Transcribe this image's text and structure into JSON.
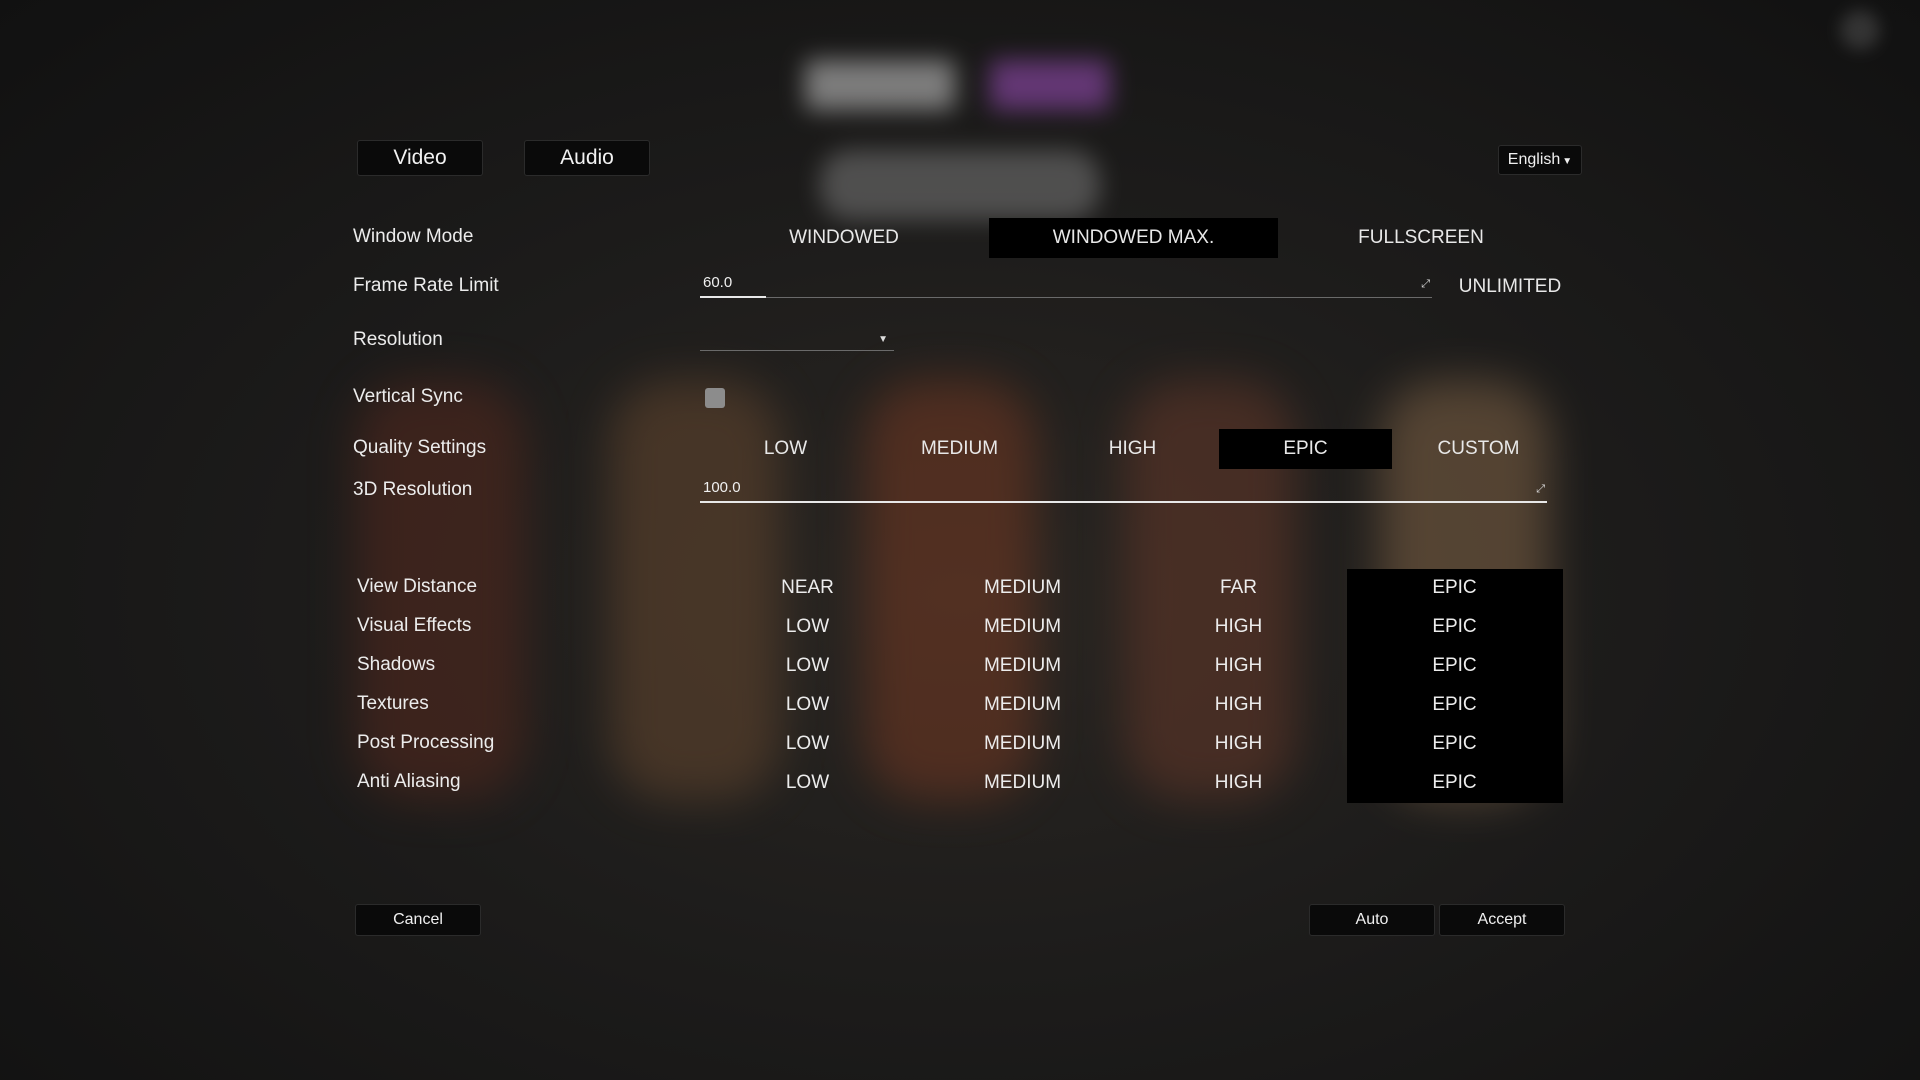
{
  "tabs": [
    {
      "label": "Video"
    },
    {
      "label": "Audio"
    }
  ],
  "language": {
    "selected": "English"
  },
  "window_mode": {
    "label": "Window Mode",
    "options": [
      "WINDOWED",
      "WINDOWED MAX.",
      "FULLSCREEN"
    ],
    "selected": "WINDOWED MAX."
  },
  "frame_rate": {
    "label": "Frame Rate Limit",
    "value": "60.0",
    "fraction": 0.09,
    "unlimited_label": "UNLIMITED"
  },
  "resolution": {
    "label": "Resolution",
    "value": ""
  },
  "vsync": {
    "label": "Vertical Sync",
    "checked": false
  },
  "quality": {
    "label": "Quality Settings",
    "options": [
      "LOW",
      "MEDIUM",
      "HIGH",
      "EPIC",
      "CUSTOM"
    ],
    "selected": "EPIC"
  },
  "res3d": {
    "label": "3D Resolution",
    "value": "100.0",
    "fraction": 1.0
  },
  "detail_settings": [
    {
      "label": "View Distance",
      "options": [
        "NEAR",
        "MEDIUM",
        "FAR",
        "EPIC"
      ],
      "selected": "EPIC"
    },
    {
      "label": "Visual Effects",
      "options": [
        "LOW",
        "MEDIUM",
        "HIGH",
        "EPIC"
      ],
      "selected": "EPIC"
    },
    {
      "label": "Shadows",
      "options": [
        "LOW",
        "MEDIUM",
        "HIGH",
        "EPIC"
      ],
      "selected": "EPIC"
    },
    {
      "label": "Textures",
      "options": [
        "LOW",
        "MEDIUM",
        "HIGH",
        "EPIC"
      ],
      "selected": "EPIC"
    },
    {
      "label": "Post Processing",
      "options": [
        "LOW",
        "MEDIUM",
        "HIGH",
        "EPIC"
      ],
      "selected": "EPIC"
    },
    {
      "label": "Anti Aliasing",
      "options": [
        "LOW",
        "MEDIUM",
        "HIGH",
        "EPIC"
      ],
      "selected": "EPIC"
    }
  ],
  "buttons": {
    "cancel": "Cancel",
    "auto": "Auto",
    "accept": "Accept"
  },
  "colors": {
    "selected_bg": "#000000",
    "text": "#ececec",
    "panel_bg": "#1c1c1c"
  }
}
